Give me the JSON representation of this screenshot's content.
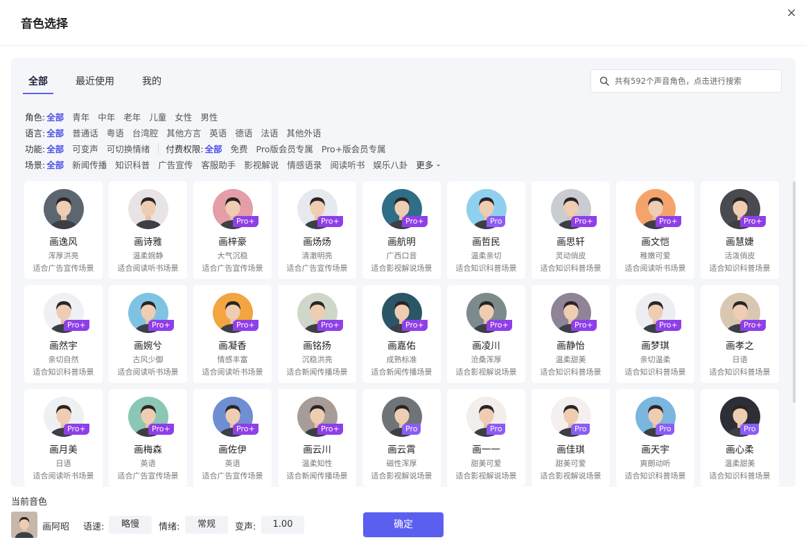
{
  "dialog": {
    "title": "音色选择",
    "close_label": "×"
  },
  "tabs": [
    {
      "label": "全部"
    },
    {
      "label": "最近使用"
    },
    {
      "label": "我的"
    }
  ],
  "search": {
    "placeholder": "共有592个声音角色，点击进行搜索"
  },
  "filters": {
    "role": {
      "label": "角色:",
      "options": [
        "全部",
        "青年",
        "中年",
        "老年",
        "儿童",
        "女性",
        "男性"
      ]
    },
    "language": {
      "label": "语言:",
      "options": [
        "全部",
        "普通话",
        "粤语",
        "台湾腔",
        "其他方言",
        "英语",
        "德语",
        "法语",
        "其他外语"
      ]
    },
    "function": {
      "label": "功能:",
      "options": [
        "全部",
        "可变声",
        "可切换情绪"
      ]
    },
    "payment": {
      "label": "付费权限:",
      "options": [
        "全部",
        "免费",
        "Pro版会员专属",
        "Pro+版会员专属"
      ]
    },
    "scene": {
      "label": "场景:",
      "options": [
        "全部",
        "新闻传播",
        "知识科普",
        "广告宣传",
        "客服助手",
        "影视解说",
        "情感语录",
        "阅读听书",
        "娱乐八卦"
      ],
      "more_label": "更多"
    }
  },
  "voices": [
    {
      "name": "画逸风",
      "desc": "浑厚洪亮",
      "scene": "适合广告宣传场景",
      "badge": "",
      "color": "#5b6670"
    },
    {
      "name": "画诗雅",
      "desc": "温柔婉静",
      "scene": "适合阅读听书场景",
      "badge": "",
      "color": "#e8e4e6"
    },
    {
      "name": "画梓豪",
      "desc": "大气沉稳",
      "scene": "适合广告宣传场景",
      "badge": "Pro+",
      "color": "#e39ea8"
    },
    {
      "name": "画炀炀",
      "desc": "清澈明亮",
      "scene": "适合广告宣传场景",
      "badge": "Pro+",
      "color": "#e6e9ee"
    },
    {
      "name": "画航明",
      "desc": "广西口音",
      "scene": "适合影视解说场景",
      "badge": "Pro+",
      "color": "#2e6e86"
    },
    {
      "name": "画哲民",
      "desc": "温柔亲切",
      "scene": "适合知识科普场景",
      "badge": "Pro",
      "color": "#8fd0ee"
    },
    {
      "name": "画思轩",
      "desc": "灵动俏皮",
      "scene": "适合知识科普场景",
      "badge": "Pro+",
      "color": "#c9ccd1"
    },
    {
      "name": "画文恺",
      "desc": "稚嫩可爱",
      "scene": "适合阅读听书场景",
      "badge": "Pro+",
      "color": "#f4a46a"
    },
    {
      "name": "画慧婕",
      "desc": "活泼俏皮",
      "scene": "适合知识科普场景",
      "badge": "Pro+",
      "color": "#4a4b50"
    },
    {
      "name": "画然宇",
      "desc": "亲切自然",
      "scene": "适合知识科普场景",
      "badge": "Pro+",
      "color": "#eef0f3"
    },
    {
      "name": "画婉兮",
      "desc": "古风少御",
      "scene": "适合阅读听书场景",
      "badge": "Pro+",
      "color": "#7fc3e2"
    },
    {
      "name": "画凝香",
      "desc": "情感丰富",
      "scene": "适合阅读听书场景",
      "badge": "Pro+",
      "color": "#f2a540"
    },
    {
      "name": "画铭扬",
      "desc": "沉稳洪亮",
      "scene": "适合新闻传播场景",
      "badge": "Pro+",
      "color": "#cfd8c8"
    },
    {
      "name": "画嘉佑",
      "desc": "成熟标准",
      "scene": "适合新闻传播场景",
      "badge": "Pro+",
      "color": "#2a5668"
    },
    {
      "name": "画凌川",
      "desc": "沧桑浑厚",
      "scene": "适合影视解说场景",
      "badge": "Pro+",
      "color": "#7d8a8c"
    },
    {
      "name": "画静怡",
      "desc": "温柔甜美",
      "scene": "适合知识科普场景",
      "badge": "Pro+",
      "color": "#8e8496"
    },
    {
      "name": "画梦琪",
      "desc": "亲切温柔",
      "scene": "适合知识科普场景",
      "badge": "Pro+",
      "color": "#eceef1"
    },
    {
      "name": "画孝之",
      "desc": "日语",
      "scene": "适合知识科普场景",
      "badge": "Pro+",
      "color": "#d8c8b2"
    },
    {
      "name": "画月美",
      "desc": "日语",
      "scene": "适合阅读听书场景",
      "badge": "Pro+",
      "color": "#eef0f2"
    },
    {
      "name": "画梅森",
      "desc": "英语",
      "scene": "适合广告宣传场景",
      "badge": "Pro+",
      "color": "#8cc7b6"
    },
    {
      "name": "画佐伊",
      "desc": "英语",
      "scene": "适合广告宣传场景",
      "badge": "Pro+",
      "color": "#6f8fd2"
    },
    {
      "name": "画云川",
      "desc": "温柔知性",
      "scene": "适合新闻传播场景",
      "badge": "Pro+",
      "color": "#a89c98"
    },
    {
      "name": "画云霄",
      "desc": "磁性浑厚",
      "scene": "适合影视解说场景",
      "badge": "Pro",
      "color": "#6e7478"
    },
    {
      "name": "画一一",
      "desc": "甜美可爱",
      "scene": "适合影视解说场景",
      "badge": "Pro",
      "color": "#f1eeec"
    },
    {
      "name": "画佳琪",
      "desc": "甜美可爱",
      "scene": "适合影视解说场景",
      "badge": "Pro",
      "color": "#f3f0ef"
    },
    {
      "name": "画天宇",
      "desc": "爽朗动听",
      "scene": "适合知识科普场景",
      "badge": "Pro",
      "color": "#7ab6dd"
    },
    {
      "name": "画心柔",
      "desc": "温柔甜美",
      "scene": "适合知识科普场景",
      "badge": "Pro",
      "color": "#2e2f36"
    }
  ],
  "current": {
    "label": "当前音色",
    "name": "画阿昭",
    "speed_label": "语速:",
    "speed_value": "略慢",
    "emotion_label": "情绪:",
    "emotion_value": "常规",
    "voice_change_label": "变声:",
    "voice_change_value": "1.00",
    "avatar_color": "#c8b8aa"
  },
  "confirm_label": "确定",
  "colors": {
    "accent": "#5b5ff0",
    "badge_pro_plus": "#8f3fe8",
    "badge_pro": "#8b5cf6"
  }
}
